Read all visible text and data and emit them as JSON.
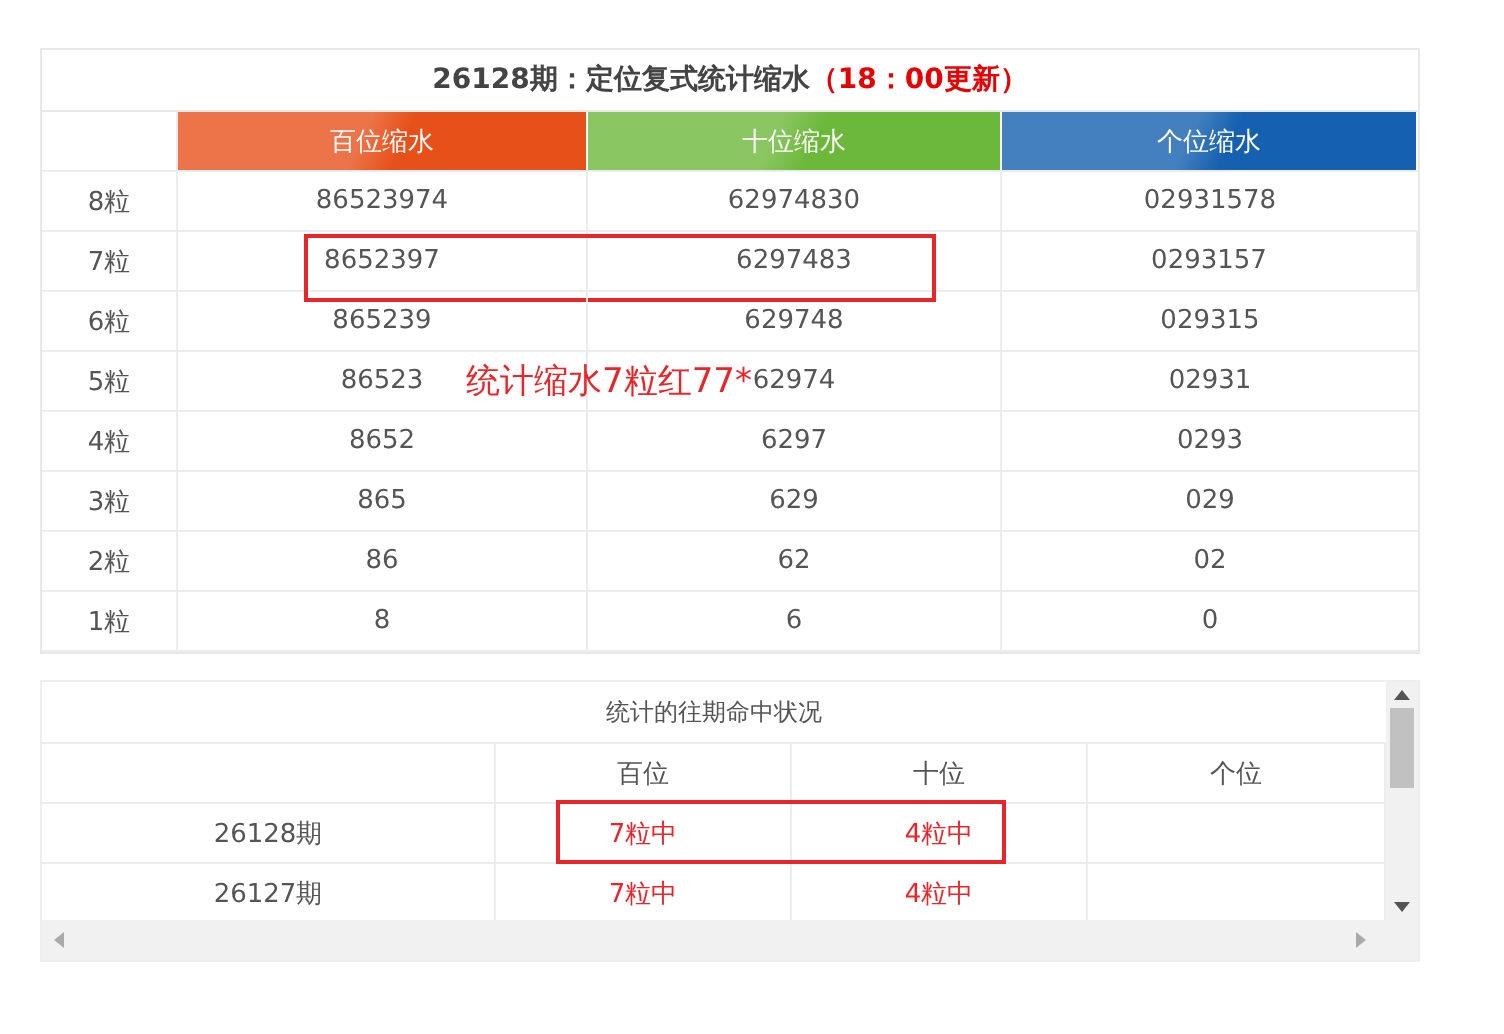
{
  "forecast_table": {
    "title_period": "26128期：定位复式统计缩水",
    "title_update": "（18：00更新）",
    "columns": [
      {
        "label": "百位缩水",
        "color": "#e8501a"
      },
      {
        "label": "十位缩水",
        "color": "#6cb83a"
      },
      {
        "label": "个位缩水",
        "color": "#1560b0"
      }
    ],
    "rows": [
      {
        "label": "8粒",
        "values": [
          "86523974",
          "62974830",
          "02931578"
        ],
        "highlighted": false
      },
      {
        "label": "7粒",
        "values": [
          "8652397",
          "6297483",
          "0293157"
        ],
        "highlighted": true
      },
      {
        "label": "6粒",
        "values": [
          "865239",
          "629748",
          "029315"
        ],
        "highlighted": false
      },
      {
        "label": "5粒",
        "values": [
          "86523",
          "62974",
          "02931"
        ],
        "highlighted": false
      },
      {
        "label": "4粒",
        "values": [
          "8652",
          "6297",
          "0293"
        ],
        "highlighted": false
      },
      {
        "label": "3粒",
        "values": [
          "865",
          "629",
          "029"
        ],
        "highlighted": false
      },
      {
        "label": "2粒",
        "values": [
          "86",
          "62",
          "02"
        ],
        "highlighted": false
      },
      {
        "label": "1粒",
        "values": [
          "8",
          "6",
          "0"
        ],
        "highlighted": false
      }
    ]
  },
  "annotation": "统计缩水7粒红77*",
  "history_table": {
    "title": "统计的往期命中状况",
    "columns": [
      "百位",
      "十位",
      "个位"
    ],
    "rows": [
      {
        "period": "26128期",
        "values": [
          "7粒中",
          "4粒中"
        ],
        "highlighted": true
      },
      {
        "period": "26127期",
        "values": [
          "7粒中",
          "4粒中"
        ],
        "highlighted": false
      }
    ]
  }
}
